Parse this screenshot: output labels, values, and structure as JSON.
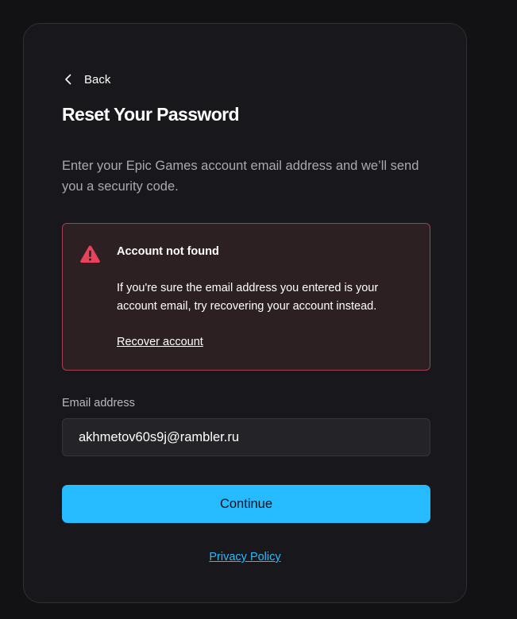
{
  "nav": {
    "back_label": "Back",
    "back_icon": "chevron-left-icon"
  },
  "header": {
    "title": "Reset Your Password",
    "description": "Enter your Epic Games account email address and we’ll send you a security code."
  },
  "alert": {
    "icon": "warning-triangle-icon",
    "title": "Account not found",
    "body": "If you're sure the email address you entered is your account email, try recovering your account instead.",
    "link_label": "Recover account",
    "colors": {
      "border": "#a54152",
      "background": "#2c2023",
      "icon": "#e8435a"
    }
  },
  "form": {
    "email_label": "Email address",
    "email_value": "akhmetov60s9j@rambler.ru",
    "continue_label": "Continue"
  },
  "footer": {
    "privacy_label": "Privacy Policy"
  },
  "colors": {
    "accent": "#26bbff",
    "page_background": "#121215",
    "card_background": "#18181c"
  }
}
